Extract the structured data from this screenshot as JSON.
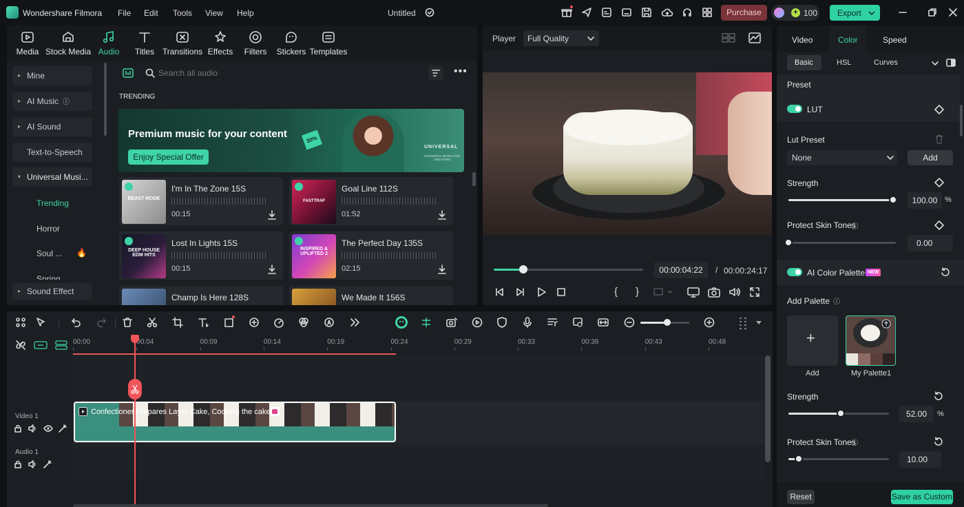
{
  "app": {
    "name": "Wondershare Filmora",
    "project_title": "Untitled"
  },
  "menu": [
    "File",
    "Edit",
    "Tools",
    "View",
    "Help"
  ],
  "titlebar": {
    "purchase": "Purchase",
    "credits": "100",
    "export": "Export"
  },
  "library": {
    "tabs": [
      "Media",
      "Stock Media",
      "Audio",
      "Titles",
      "Transitions",
      "Effects",
      "Filters",
      "Stickers",
      "Templates"
    ],
    "active_tab": "Audio",
    "search_placeholder": "Search all audio",
    "nav": [
      "Mine",
      "AI Music",
      "AI Sound Effect",
      "Text-to-Speech",
      "Universal Musi..."
    ],
    "sub_nav": [
      "Trending",
      "Horror",
      "Soul ...",
      "Spring"
    ],
    "nav_bottom": "Sound Effect",
    "section": "TRENDING",
    "banner": {
      "title": "Premium music for your content",
      "button": "Enjoy Special Offer",
      "badge": "30%",
      "brand": "UNIVERSAL",
      "brand_sub": "UNIVERSAL MUSIC FOR CREATORS"
    },
    "tracks": [
      {
        "name": "I'm In The Zone 15S",
        "duration": "00:15",
        "art": "BEAST MODE"
      },
      {
        "name": "Goal Line 112S",
        "duration": "01:52",
        "art": "FASTTRAP"
      },
      {
        "name": "Lost In Lights 15S",
        "duration": "00:15",
        "art": "DEEP HOUSE EDM HITS"
      },
      {
        "name": "The Perfect Day 135S",
        "duration": "02:15",
        "art": "INSPIRED & UPLIFTED 2"
      },
      {
        "name": "Champ Is Here 128S",
        "duration": "",
        "art": ""
      },
      {
        "name": "We Made It 156S",
        "duration": "",
        "art": ""
      }
    ]
  },
  "player": {
    "label": "Player",
    "quality": "Full Quality",
    "current": "00:00:04:22",
    "separator": "/",
    "total": "00:00:24:17",
    "progress": 0.2,
    "bracket_in": "{",
    "bracket_out": "}"
  },
  "right": {
    "tabs": [
      "Video",
      "Color",
      "Speed"
    ],
    "active_tab": "Color",
    "sub_tabs": [
      "Basic",
      "HSL",
      "Curves"
    ],
    "preset": "Preset",
    "lut": "LUT",
    "lut_preset_label": "Lut Preset",
    "lut_preset_value": "None",
    "add": "Add",
    "strength_label": "Strength",
    "strength_value": "100.00",
    "strength_unit": "%",
    "strength_level": 1.0,
    "protect_label": "Protect Skin Tones",
    "protect_value": "0.00",
    "protect_level": 0.0,
    "ai_palette": "AI Color Palette",
    "new_badge": "NEW",
    "add_palette": "Add Palette",
    "palette_add": "Add",
    "palette_name": "My Palette1",
    "strength2_value": "52.00",
    "strength2_level": 0.52,
    "protect2_value": "10.00",
    "protect2_level": 0.1,
    "reset": "Reset",
    "save_custom": "Save as Custom"
  },
  "timeline": {
    "ruler": [
      "00:00",
      "00:04",
      "00:09",
      "00:14",
      "00:19",
      "00:24",
      "00:29",
      "00:33",
      "00:38",
      "00:43",
      "00:48"
    ],
    "tracks": [
      "Video 1",
      "Audio 1"
    ],
    "clip_title": "Confectioner Prepares Layer Cake, Cooking the cake"
  },
  "colors": {
    "accent": "#3fd3a8",
    "purchase": "#7a3439",
    "export": "#2fd1a3",
    "clip": "#3a8f7e",
    "playhead": "#f0555a"
  }
}
